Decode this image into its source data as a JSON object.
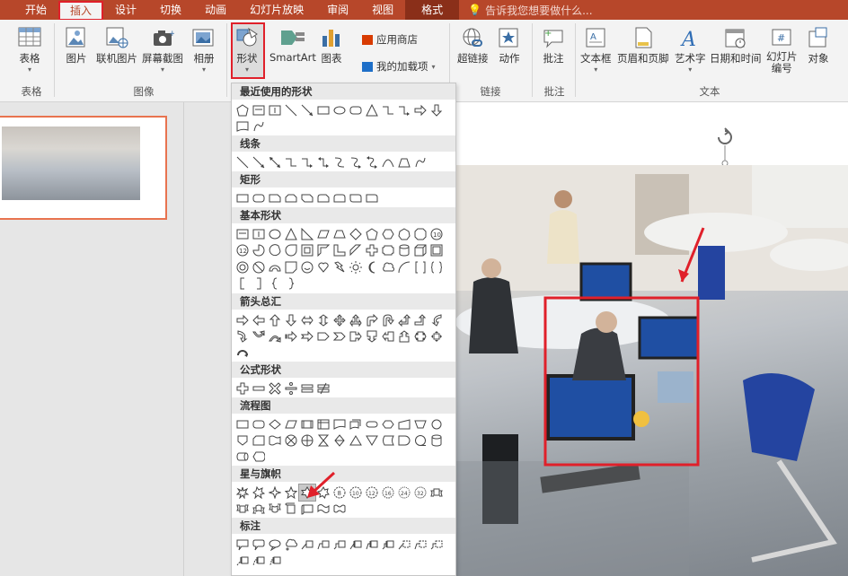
{
  "tabs": [
    "开始",
    "插入",
    "设计",
    "切换",
    "动画",
    "幻灯片放映",
    "审阅",
    "视图",
    "格式"
  ],
  "tell_me": "告诉我您想要做什么...",
  "ribbon": {
    "table_btn": "表格",
    "table_group": "表格",
    "picture_btn": "图片",
    "online_picture_btn": "联机图片",
    "screenshot_btn": "屏幕截图",
    "album_btn": "相册",
    "images_group": "图像",
    "shapes_btn": "形状",
    "smartart_btn": "SmartArt",
    "chart_btn": "图表",
    "store_btn": "应用商店",
    "my_addins_btn": "我的加载项",
    "hyperlink_btn": "超链接",
    "action_btn": "动作",
    "links_group": "链接",
    "comment_btn": "批注",
    "comments_group": "批注",
    "textbox_btn": "文本框",
    "header_footer_btn": "页眉和页脚",
    "wordart_btn": "艺术字",
    "datetime_btn": "日期和时间",
    "slide_number_btn_1": "幻灯片",
    "slide_number_btn_2": "编号",
    "object_btn": "对象",
    "text_group": "文本"
  },
  "shapes_menu": {
    "sections": [
      "最近使用的形状",
      "线条",
      "矩形",
      "基本形状",
      "箭头总汇",
      "公式形状",
      "流程图",
      "星与旗帜",
      "标注"
    ]
  },
  "colors": {
    "accent": "#b7472a",
    "highlight": "#e0202a"
  }
}
